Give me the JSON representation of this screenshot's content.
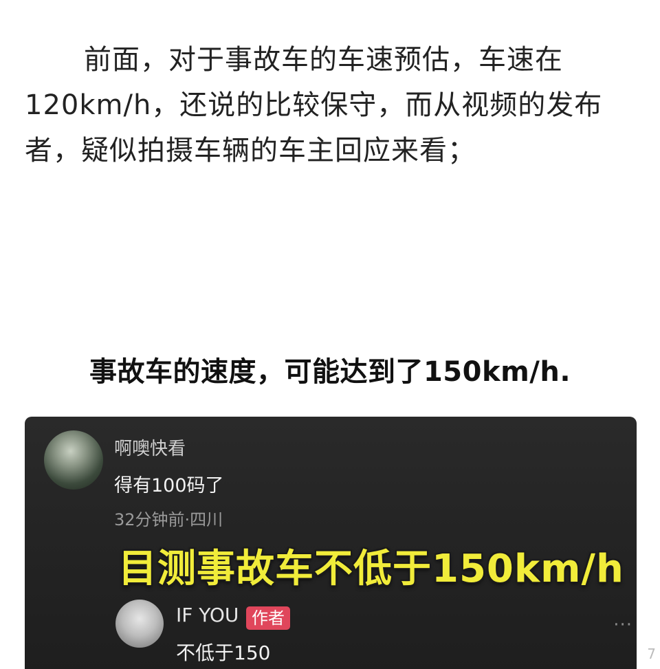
{
  "article": {
    "intro": "前面，对于事故车的车速预估，车速在120km/h，还说的比较保守，而从视频的发布者，疑似拍摄车辆的车主回应来看；",
    "headline": "事故车的速度，可能达到了150km/h."
  },
  "screenshot": {
    "comment1": {
      "username": "啊噢快看",
      "text": "得有100码了",
      "meta": "32分钟前·四川"
    },
    "overlay_text": "目测事故车不低于150km/h",
    "comment2": {
      "username": "IF YOU",
      "badge": "作者",
      "text": "不低于150"
    },
    "more_icon": "more-dots-icon"
  },
  "corner_mark": "7"
}
